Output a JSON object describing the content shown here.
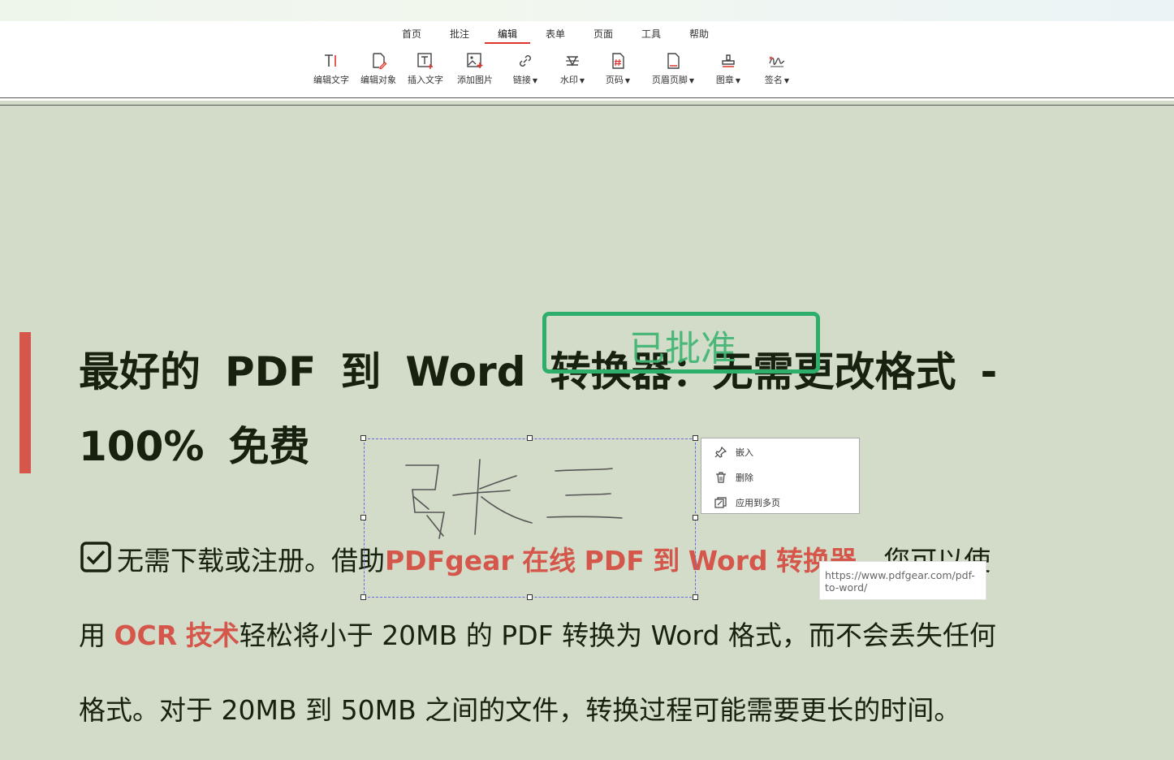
{
  "menu": {
    "tabs": [
      {
        "label": "首页"
      },
      {
        "label": "批注"
      },
      {
        "label": "编辑"
      },
      {
        "label": "表单"
      },
      {
        "label": "页面"
      },
      {
        "label": "工具"
      },
      {
        "label": "帮助"
      }
    ],
    "active": "编辑"
  },
  "toolbar": {
    "tools": [
      {
        "label": "编辑文字",
        "icon": "edit-text-icon"
      },
      {
        "label": "编辑对象",
        "icon": "edit-object-icon"
      },
      {
        "label": "插入文字",
        "icon": "insert-text-icon"
      },
      {
        "label": "添加图片",
        "icon": "add-image-icon"
      },
      {
        "label": "链接",
        "icon": "link-icon"
      },
      {
        "label": "水印",
        "icon": "watermark-icon"
      },
      {
        "label": "页码",
        "icon": "page-number-icon"
      },
      {
        "label": "页眉页脚",
        "icon": "header-footer-icon"
      },
      {
        "label": "图章",
        "icon": "stamp-icon"
      },
      {
        "label": "签名",
        "icon": "signature-icon"
      }
    ]
  },
  "document": {
    "heading_line1": [
      "最好的",
      "PDF",
      "到",
      "Word",
      "转换器：无需更改格式",
      "-"
    ],
    "heading_line2": [
      "100%",
      "免费"
    ],
    "para_line1": {
      "a": "无需下载或注册。借助",
      "b": "PDFgear",
      "c": "在线",
      "d": "PDF",
      "e": "到",
      "f": "Word",
      "g": "转换器",
      "h": "，您可以使"
    },
    "para_line2": {
      "a": "用",
      "b": "OCR",
      "c": "技术",
      "d": "轻松将小于",
      "e": "20MB",
      "f": "的",
      "g": "PDF",
      "h": "转换为",
      "i": "Word",
      "j": "格式，而不会丢失任何"
    },
    "para_line3": {
      "a": "格式。对于",
      "b": "20MB",
      "c": "到",
      "d": "50MB",
      "e": "之间的文件，转换过程可能需要更长的时间。"
    }
  },
  "stamp": {
    "text": "已批准",
    "color": "#2eae6b"
  },
  "signature": {
    "text": "张三"
  },
  "context_menu": {
    "items": [
      {
        "label": "嵌入",
        "icon": "pin-icon"
      },
      {
        "label": "删除",
        "icon": "trash-icon"
      },
      {
        "label": "应用到多页",
        "icon": "apply-pages-icon"
      }
    ]
  },
  "tooltip": {
    "text": "https://www.pdfgear.com/pdf-to-word/"
  },
  "colors": {
    "accent": "#e0332b",
    "link_red": "#d5574b",
    "page_bg": "#d2dcc9"
  }
}
